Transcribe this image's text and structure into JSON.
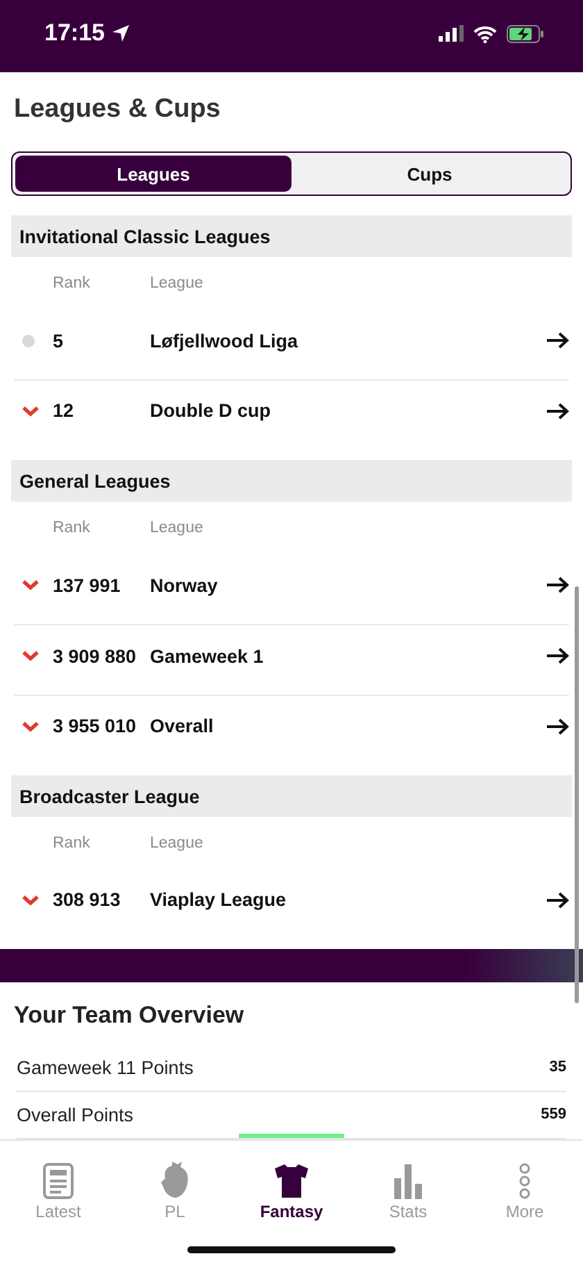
{
  "status_bar": {
    "time": "17:15"
  },
  "title": "Leagues & Cups",
  "tabs": [
    {
      "label": "Leagues",
      "selected": true
    },
    {
      "label": "Cups",
      "selected": false
    }
  ],
  "sections": [
    {
      "title": "Invitational Classic Leagues",
      "columns": [
        "Rank",
        "League"
      ],
      "rows": [
        {
          "kind": "same",
          "rank": "5",
          "league": "Løfjellwood Liga"
        },
        {
          "kind": "down",
          "rank": "12",
          "league": "Double D cup"
        }
      ]
    },
    {
      "title": "General Leagues",
      "columns": [
        "Rank",
        "League"
      ],
      "rows": [
        {
          "kind": "down",
          "rank": "137 991",
          "league": "Norway"
        },
        {
          "kind": "down",
          "rank": "3 909 880",
          "league": "Gameweek 1"
        },
        {
          "kind": "down",
          "rank": "3 955 010",
          "league": "Overall"
        }
      ]
    },
    {
      "title": "Broadcaster League",
      "columns": [
        "Rank",
        "League"
      ],
      "rows": [
        {
          "kind": "down",
          "rank": "308 913",
          "league": "Viaplay League"
        }
      ]
    }
  ],
  "overview": {
    "title": "Your Team Overview",
    "rows": [
      {
        "label": "Gameweek 11 Points",
        "value": "35"
      },
      {
        "label": "Overall Points",
        "value": "559"
      }
    ]
  },
  "nav": [
    {
      "label": "Latest",
      "kind": "news",
      "selected": false
    },
    {
      "label": "PL",
      "kind": "lion",
      "selected": false
    },
    {
      "label": "Fantasy",
      "kind": "shirt",
      "selected": true
    },
    {
      "label": "Stats",
      "kind": "bars",
      "selected": false
    },
    {
      "label": "More",
      "kind": "dots",
      "selected": false
    }
  ]
}
